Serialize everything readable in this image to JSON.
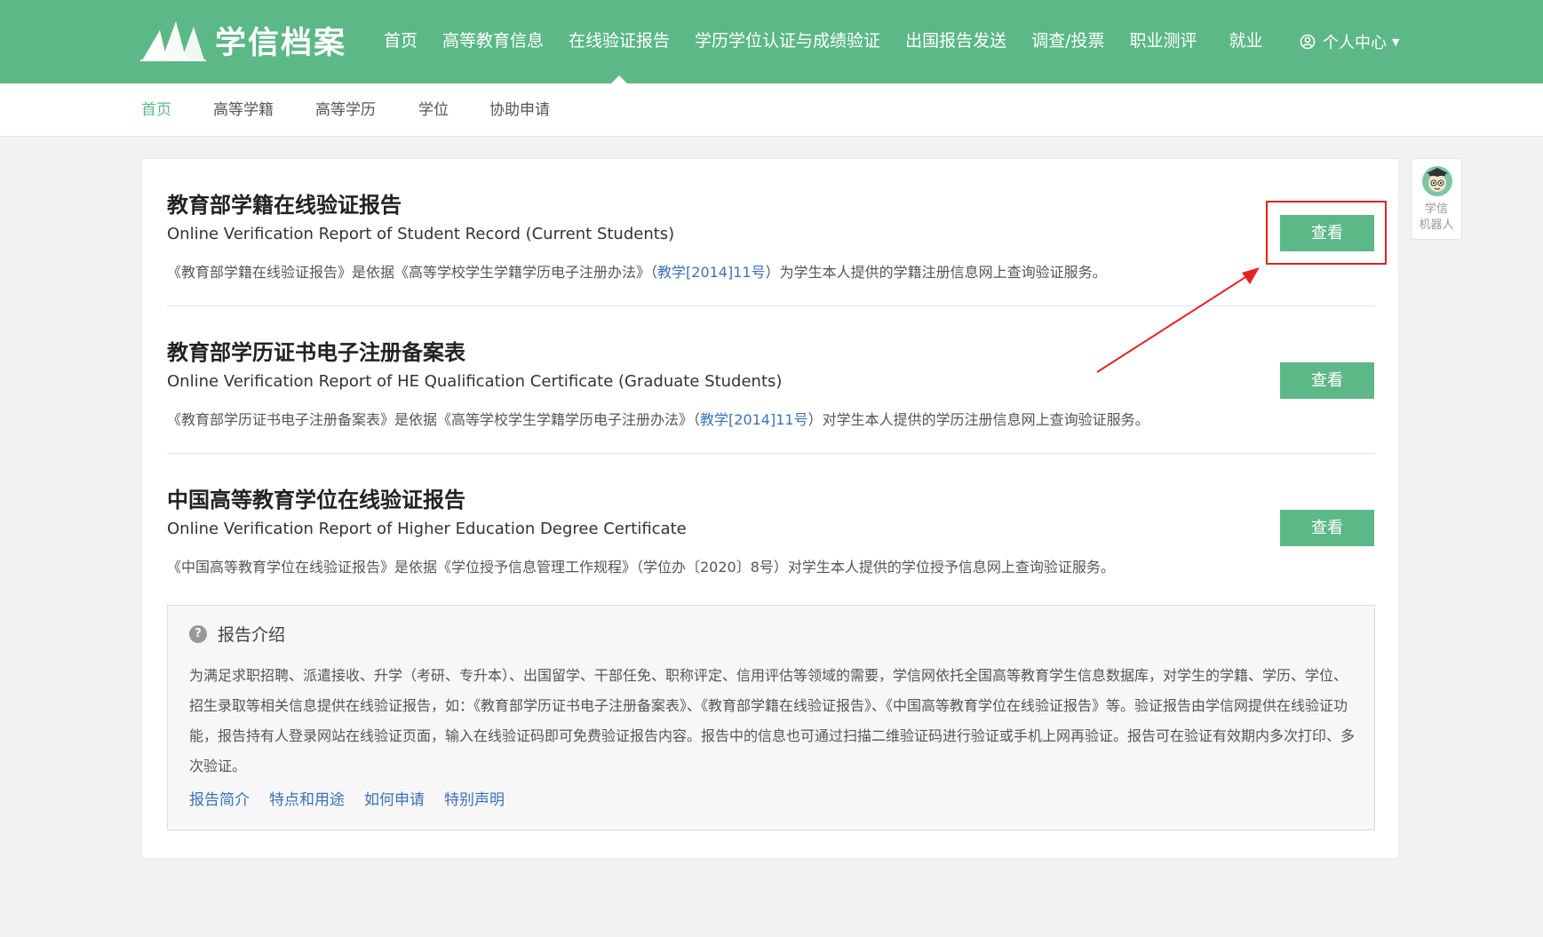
{
  "header": {
    "logo_text": "学信档案",
    "nav": [
      {
        "label": "首页"
      },
      {
        "label": "高等教育信息"
      },
      {
        "label": "在线验证报告"
      },
      {
        "label": "学历学位认证与成绩验证"
      },
      {
        "label": "出国报告发送"
      },
      {
        "label": "调查/投票"
      },
      {
        "label": "职业测评"
      },
      {
        "label": "就业"
      }
    ],
    "active_nav": "在线验证报告",
    "user_menu_label": "个人中心"
  },
  "subnav": {
    "items": [
      {
        "label": "首页"
      },
      {
        "label": "高等学籍"
      },
      {
        "label": "高等学历"
      },
      {
        "label": "学位"
      },
      {
        "label": "协助申请"
      }
    ],
    "active": "首页"
  },
  "reports": [
    {
      "title": "教育部学籍在线验证报告",
      "subtitle": "Online Verification Report of Student Record (Current Students)",
      "desc_before": "《教育部学籍在线验证报告》是依据《高等学校学生学籍学历电子注册办法》（",
      "desc_link": "教学[2014]11号",
      "desc_after": "）为学生本人提供的学籍注册信息网上查询验证服务。",
      "button": "查看"
    },
    {
      "title": "教育部学历证书电子注册备案表",
      "subtitle": "Online Verification Report of HE Qualification Certificate (Graduate Students)",
      "desc_before": "《教育部学历证书电子注册备案表》是依据《高等学校学生学籍学历电子注册办法》（",
      "desc_link": "教学[2014]11号",
      "desc_after": "）对学生本人提供的学历注册信息网上查询验证服务。",
      "button": "查看"
    },
    {
      "title": "中国高等教育学位在线验证报告",
      "subtitle": "Online Verification Report of Higher Education Degree Certificate",
      "desc_before": "《中国高等教育学位在线验证报告》是依据《学位授予信息管理工作规程》（学位办〔2020〕8号）对学生本人提供的学位授予信息网上查询验证服务。",
      "desc_link": "",
      "desc_after": "",
      "button": "查看"
    }
  ],
  "intro": {
    "title": "报告介绍",
    "body": "为满足求职招聘、派遣接收、升学（考研、专升本）、出国留学、干部任免、职称评定、信用评估等领域的需要，学信网依托全国高等教育学生信息数据库，对学生的学籍、学历、学位、招生录取等相关信息提供在线验证报告，如：《教育部学历证书电子注册备案表》、《教育部学籍在线验证报告》、《中国高等教育学位在线验证报告》等。验证报告由学信网提供在线验证功能，报告持有人登录网站在线验证页面，输入在线验证码即可免费验证报告内容。报告中的信息也可通过扫描二维验证码进行验证或手机上网再验证。报告可在验证有效期内多次打印、多次验证。",
    "links": [
      {
        "label": "报告简介"
      },
      {
        "label": "特点和用途"
      },
      {
        "label": "如何申请"
      },
      {
        "label": "特别声明"
      }
    ]
  },
  "robot": {
    "label_line1": "学信",
    "label_line2": "机器人"
  },
  "colors": {
    "brand_green": "#5cb886",
    "link_blue": "#3b72b8",
    "annotation_red": "#e52222"
  }
}
